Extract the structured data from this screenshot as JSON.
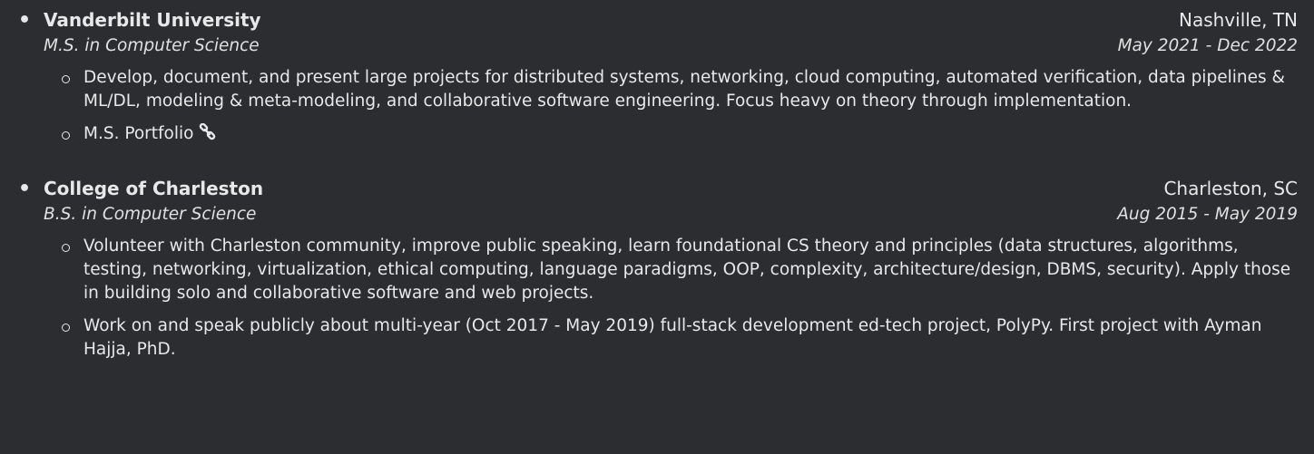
{
  "education": [
    {
      "school": "Vanderbilt University",
      "location": "Nashville, TN",
      "degree": "M.S. in Computer Science",
      "dates": "May 2021 - Dec 2022",
      "details": [
        "Develop, document, and present large projects for distributed systems, networking, cloud computing, automated verification, data pipelines & ML/DL, modeling & meta-modeling, and collaborative software engineering. Focus heavy on theory through implementation."
      ],
      "link_label": "M.S. Portfolio",
      "link_icon": "link-icon"
    },
    {
      "school": "College of Charleston",
      "location": "Charleston, SC",
      "degree": "B.S. in Computer Science",
      "dates": "Aug 2015 - May 2019",
      "details": [
        "Volunteer with Charleston community, improve public speaking, learn foundational CS theory and principles (data structures, algorithms, testing, networking, virtualization, ethical computing, language paradigms, OOP, complexity, architecture/design, DBMS, security). Apply those in building solo and collaborative software and web projects.",
        "Work on and speak publicly about multi-year (Oct 2017 - May 2019) full-stack development ed-tech project, PolyPy. First project with Ayman Hajja, PhD."
      ]
    }
  ]
}
